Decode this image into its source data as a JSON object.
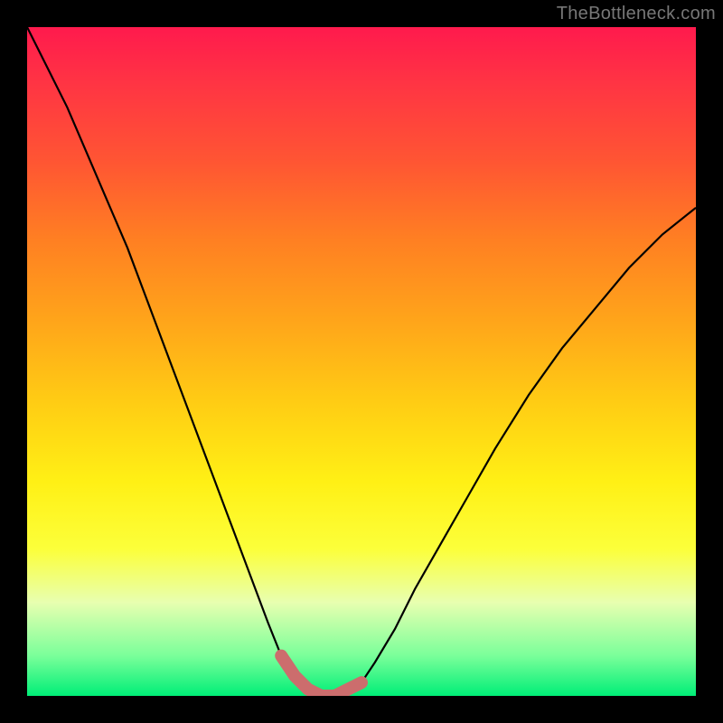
{
  "watermark": "TheBottleneck.com",
  "colors": {
    "page_bg": "#000000",
    "curve": "#000000",
    "marker": "#cc6d6d",
    "gradient_top": "#ff1a4d",
    "gradient_bottom": "#00ee77"
  },
  "chart_data": {
    "type": "line",
    "title": "",
    "xlabel": "",
    "ylabel": "",
    "xlim": [
      0,
      100
    ],
    "ylim": [
      0,
      100
    ],
    "description": "Bottleneck-style V-curve: y≈0 inside the sweet-spot band, rises steeply on both sides. y is plotted inverted (0 at bottom = good/green, 100 at top = bad/red).",
    "x": [
      0,
      3,
      6,
      9,
      12,
      15,
      18,
      21,
      24,
      27,
      30,
      33,
      36,
      38,
      40,
      42,
      44,
      46,
      48,
      50,
      52,
      55,
      58,
      62,
      66,
      70,
      75,
      80,
      85,
      90,
      95,
      100
    ],
    "y": [
      100,
      94,
      88,
      81,
      74,
      67,
      59,
      51,
      43,
      35,
      27,
      19,
      11,
      6,
      3,
      1,
      0,
      0,
      1,
      2,
      5,
      10,
      16,
      23,
      30,
      37,
      45,
      52,
      58,
      64,
      69,
      73
    ],
    "sweet_spot": {
      "x_start": 38,
      "x_end": 50,
      "y_max": 6
    },
    "gradient_stops": [
      {
        "pct": 0,
        "hex": "#ff1a4d"
      },
      {
        "pct": 20,
        "hex": "#ff5533"
      },
      {
        "pct": 44,
        "hex": "#ffa51a"
      },
      {
        "pct": 68,
        "hex": "#fff015"
      },
      {
        "pct": 86,
        "hex": "#e8ffb0"
      },
      {
        "pct": 100,
        "hex": "#00ee77"
      }
    ]
  }
}
